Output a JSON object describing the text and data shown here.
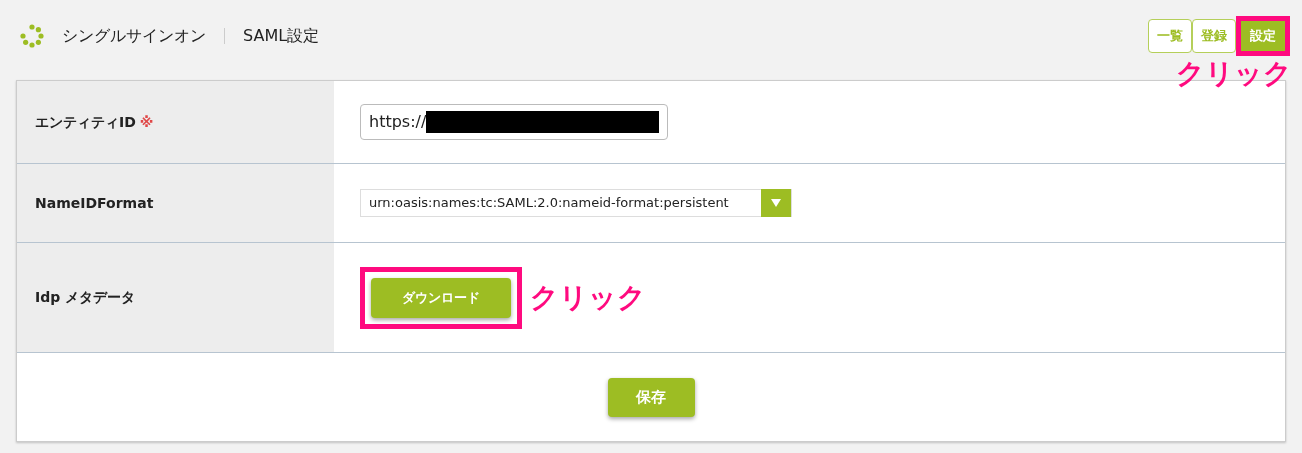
{
  "header": {
    "title": "シングルサインオン",
    "subtitle": "SAML設定"
  },
  "tabs": [
    {
      "label": "一覧",
      "selected": false,
      "highlighted": false
    },
    {
      "label": "登録",
      "selected": false,
      "highlighted": false
    },
    {
      "label": "設定",
      "selected": true,
      "highlighted": true
    }
  ],
  "tab_callout": "クリック",
  "form": {
    "rows": [
      {
        "kind": "text",
        "label": "エンティティID",
        "required_mark": "※",
        "value": "https://",
        "redacted": true
      },
      {
        "kind": "select",
        "label": "NameIDFormat",
        "value": "urn:oasis:names:tc:SAML:2.0:nameid-format:persistent"
      },
      {
        "kind": "button",
        "label": "Idp メタデータ",
        "button": "ダウンロード",
        "highlighted": true,
        "callout": "クリック"
      }
    ],
    "save_button": "保存"
  }
}
